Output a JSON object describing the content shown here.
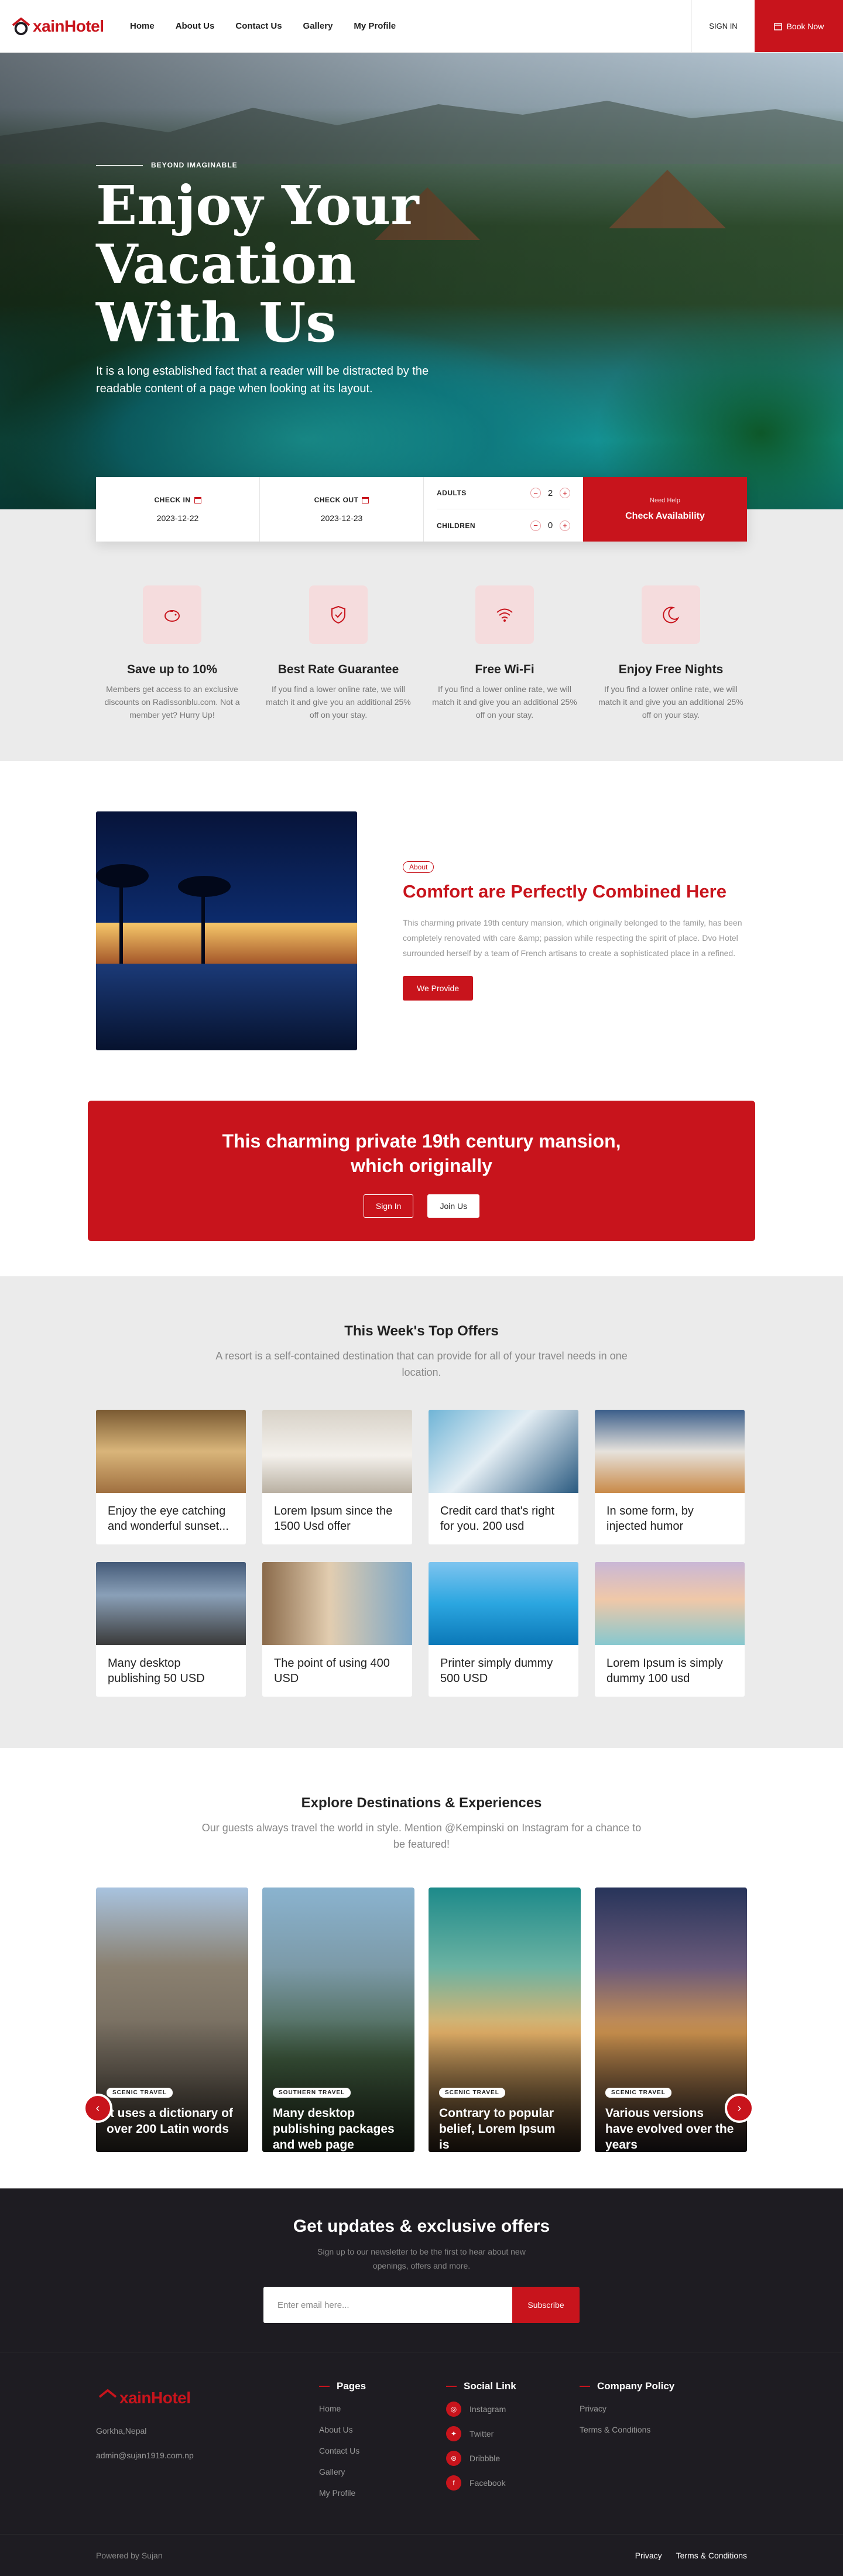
{
  "header": {
    "logo_text": "xainHotel",
    "nav": [
      "Home",
      "About Us",
      "Contact Us",
      "Gallery",
      "My Profile"
    ],
    "signin": "SIGN IN",
    "book_now": "Book Now"
  },
  "hero": {
    "tag": "BEYOND IMAGINABLE",
    "title": "Enjoy Your Vacation With Us",
    "subtitle": "It is a long established fact that a reader will be distracted by the readable content of a page when looking at its layout."
  },
  "booking": {
    "check_in_label": "CHECK IN",
    "check_in_value": "2023-12-22",
    "check_out_label": "CHECK OUT",
    "check_out_value": "2023-12-23",
    "adults_label": "ADULTS",
    "adults_value": "2",
    "children_label": "CHILDREN",
    "children_value": "0",
    "need_help": "Need Help",
    "check_availability": "Check Availability"
  },
  "features": [
    {
      "title": "Save up to 10%",
      "desc": "Members get access to an exclusive discounts on Radissonblu.com. Not a member yet? Hurry Up!",
      "icon": "piggy-bank-icon"
    },
    {
      "title": "Best Rate Guarantee",
      "desc": "If you find a lower online rate, we will match it and give you an additional 25% off on your stay.",
      "icon": "shield-check-icon"
    },
    {
      "title": "Free Wi-Fi",
      "desc": "If you find a lower online rate, we will match it and give you an additional 25% off on your stay.",
      "icon": "wifi-icon"
    },
    {
      "title": "Enjoy Free Nights",
      "desc": "If you find a lower online rate, we will match it and give you an additional 25% off on your stay.",
      "icon": "moon-icon"
    }
  ],
  "about": {
    "pill": "About",
    "title": "Comfort are Perfectly Combined Here",
    "desc": "This charming private 19th century mansion, which originally belonged to the family, has been completely renovated with care &amp; passion while respecting the spirit of place. Dvo Hotel surrounded herself by a team of French artisans to create a sophisticated place in a refined.",
    "button": "We Provide"
  },
  "cta": {
    "title": "This charming private 19th century mansion, which originally",
    "sign_in": "Sign In",
    "join_us": "Join Us"
  },
  "offers": {
    "title": "This Week's Top Offers",
    "subtitle": "A resort is a self-contained destination that can provide for all of your travel needs in one location.",
    "items": [
      "Enjoy the eye catching and wonderful sunset...",
      "Lorem Ipsum since the 1500 Usd offer",
      "Credit card that's right for you. 200 usd",
      "In some form, by injected humor",
      "Many desktop publishing 50 USD",
      "The point of using 400 USD",
      "Printer simply dummy 500 USD",
      "Lorem Ipsum is simply dummy 100 usd"
    ]
  },
  "destinations": {
    "title": "Explore Destinations & Experiences",
    "subtitle": "Our guests always travel the world in style. Mention @Kempinski on Instagram for a chance to be featured!",
    "items": [
      {
        "tag": "SCENIC TRAVEL",
        "name": "It uses a dictionary of over 200 Latin words"
      },
      {
        "tag": "SOUTHERN TRAVEL",
        "name": "Many desktop publishing packages and web page"
      },
      {
        "tag": "SCENIC TRAVEL",
        "name": "Contrary to popular belief, Lorem Ipsum is"
      },
      {
        "tag": "SCENIC TRAVEL",
        "name": "Various versions have evolved over the years"
      }
    ]
  },
  "newsletter": {
    "title": "Get updates & exclusive offers",
    "subtitle": "Sign up to our newsletter to be the first to hear about new openings, offers and more.",
    "placeholder": "Enter email here...",
    "button": "Subscribe"
  },
  "footer": {
    "logo_text": "xainHotel",
    "address": "Gorkha,Nepal",
    "email": "admin@sujan1919.com.np",
    "pages_title": "Pages",
    "pages": [
      "Home",
      "About Us",
      "Contact Us",
      "Gallery",
      "My Profile"
    ],
    "social_title": "Social Link",
    "social": [
      "Instagram",
      "Twitter",
      "Dribbble",
      "Facebook"
    ],
    "policy_title": "Company Policy",
    "policy": [
      "Privacy",
      "Terms & Conditions"
    ],
    "powered": "Powered by Sujan",
    "bottom_links": [
      "Privacy",
      "Terms & Conditions"
    ]
  },
  "colors": {
    "accent": "#c8141c",
    "dark": "#1e1c22",
    "light_bg": "#ebebeb"
  }
}
